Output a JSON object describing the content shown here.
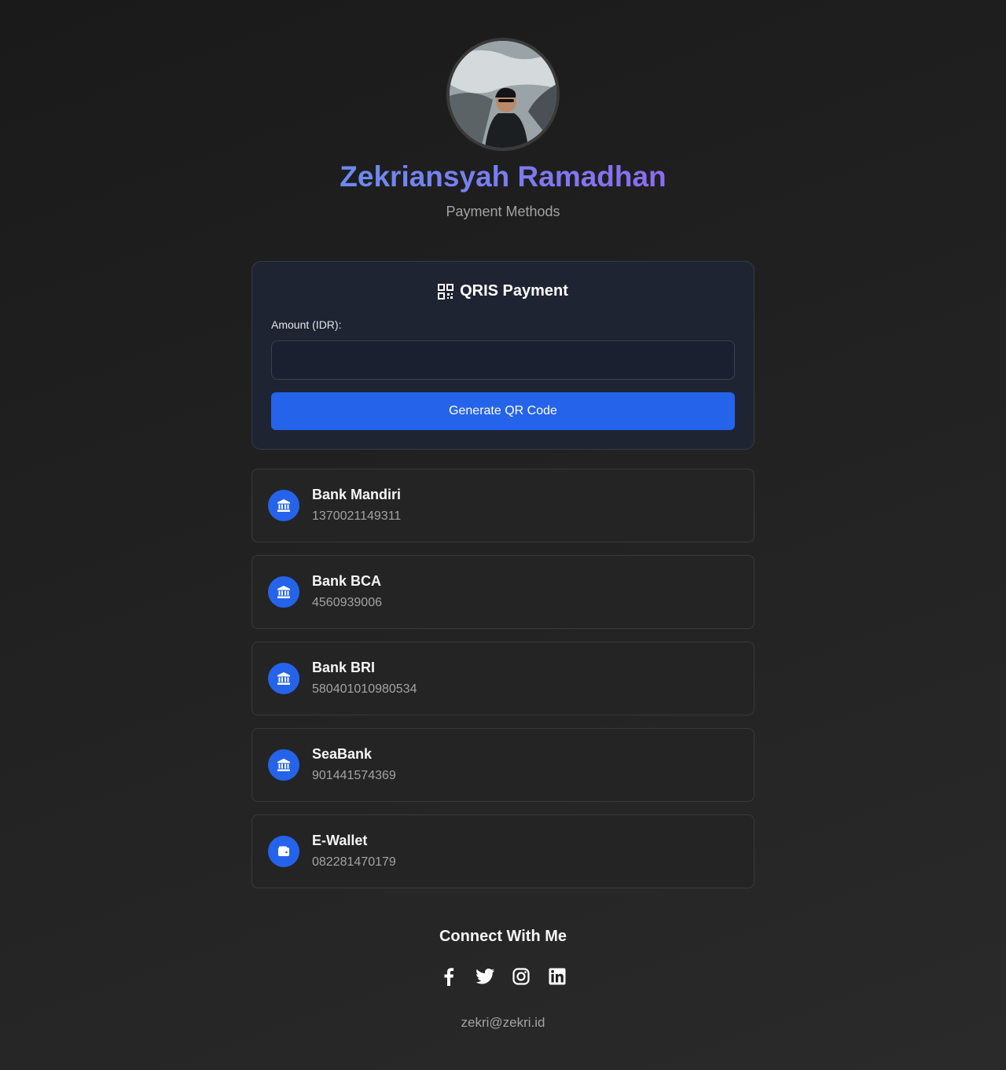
{
  "profile": {
    "name": "Zekriansyah Ramadhan",
    "subtitle": "Payment Methods"
  },
  "qris": {
    "title": "QRIS Payment",
    "icon": "qrcode-icon",
    "amount_label": "Amount (IDR):",
    "amount_value": "",
    "button_label": "Generate QR Code"
  },
  "banks": [
    {
      "name": "Bank Mandiri",
      "number": "1370021149311",
      "icon": "bank-icon"
    },
    {
      "name": "Bank BCA",
      "number": "4560939006",
      "icon": "bank-icon"
    },
    {
      "name": "Bank BRI",
      "number": "580401010980534",
      "icon": "bank-icon"
    },
    {
      "name": "SeaBank",
      "number": "901441574369",
      "icon": "bank-icon"
    },
    {
      "name": "E-Wallet",
      "number": "082281470179",
      "icon": "wallet-icon"
    }
  ],
  "connect": {
    "title": "Connect With Me",
    "socials": [
      "facebook-icon",
      "twitter-icon",
      "instagram-icon",
      "linkedin-icon"
    ],
    "email": "zekri@zekri.id"
  },
  "colors": {
    "accent": "#2563eb",
    "name_gradient_start": "#6b8cf0",
    "name_gradient_end": "#8b6cf2"
  }
}
